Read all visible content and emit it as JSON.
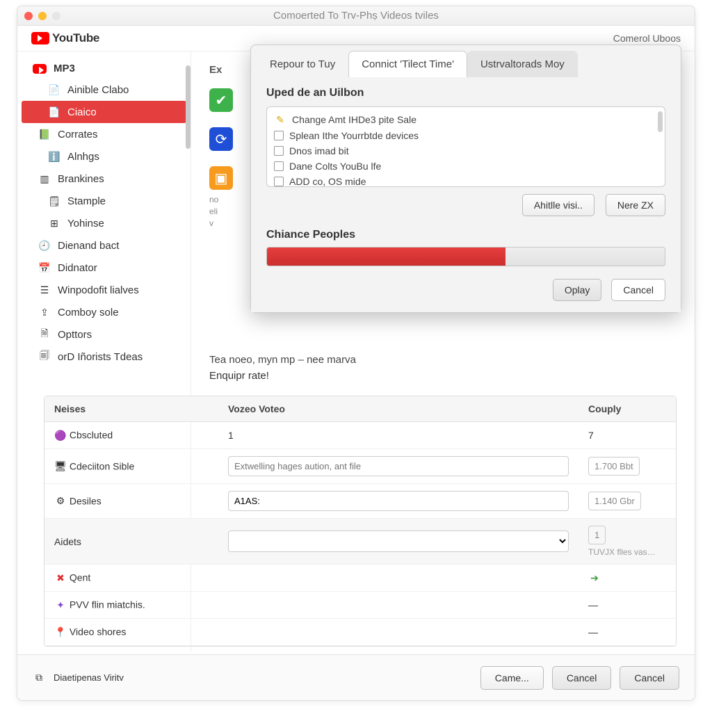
{
  "window": {
    "title": "Comoerted To Trv-Phṣ Videos tviles"
  },
  "brand": {
    "name": "YouTube"
  },
  "header_right": "Comerol Uboos",
  "sidebar": {
    "root": {
      "label": "MP3"
    },
    "items": [
      {
        "label": "Ainible Clabo"
      },
      {
        "label": "Ciaico"
      },
      {
        "label": "Corrates"
      },
      {
        "label": "Alnhgs"
      },
      {
        "label": "Brankines"
      },
      {
        "label": "Stample"
      },
      {
        "label": "Yohinse"
      },
      {
        "label": "Dienand bact"
      },
      {
        "label": "Didnator"
      },
      {
        "label": "Winpodofit lialves"
      },
      {
        "label": "Comboy sole"
      },
      {
        "label": "Opttors"
      },
      {
        "label": "orD Iñorists Tdeas"
      }
    ]
  },
  "panel": {
    "header": "Ex",
    "small_lines": "no\neli\nv",
    "line1": "Tea noeo, myn mp – nee  marva",
    "line2": "Enquipr rate!"
  },
  "dialog": {
    "tabs": [
      "Repour to Tuy",
      "Connict 'Tilect Time'",
      "Ustrvaltorads Moy"
    ],
    "heading": "Uped de an Uilbon",
    "list_first": "Change Amt IHDe3 pite Sale",
    "list": [
      "Splean Ithe Yourrbtde devices",
      "Dnos imad bit",
      "Dane Colts YouBu lfe",
      "ADD co, OS mide"
    ],
    "btn_a": "Ahitlle visi..",
    "btn_b": "Nere ZX",
    "progress_heading": "Chiance Peoples",
    "ok": "Oplay",
    "cancel": "Cancel"
  },
  "table": {
    "headers": [
      "Neises",
      "Vozeo Voteo",
      "Couply"
    ],
    "rows": [
      {
        "name": "Cbscluted",
        "v": "1",
        "c": "7"
      },
      {
        "name": "Cdeciiton Sible",
        "v_ph": "Extwelling hages aution, ant file",
        "c": "1.700 Bbt"
      },
      {
        "name": "Desiles",
        "v": "A1AS:",
        "c": "1.140 Gbr"
      },
      {
        "name": "Aidets",
        "v": "",
        "c": "1",
        "tiny": "TUVJX flles vas…"
      },
      {
        "name": "Qent",
        "v": "",
        "c_icon": "arrow"
      },
      {
        "name": "PVV flin miatchis.",
        "v": "",
        "c_icon": "dash"
      },
      {
        "name": "Video shores",
        "v": "",
        "c_icon": "dash"
      }
    ]
  },
  "footer": {
    "left": "Diaetipenas Viritv",
    "b1": "Came...",
    "b2": "Cancel",
    "b3": "Cancel"
  }
}
